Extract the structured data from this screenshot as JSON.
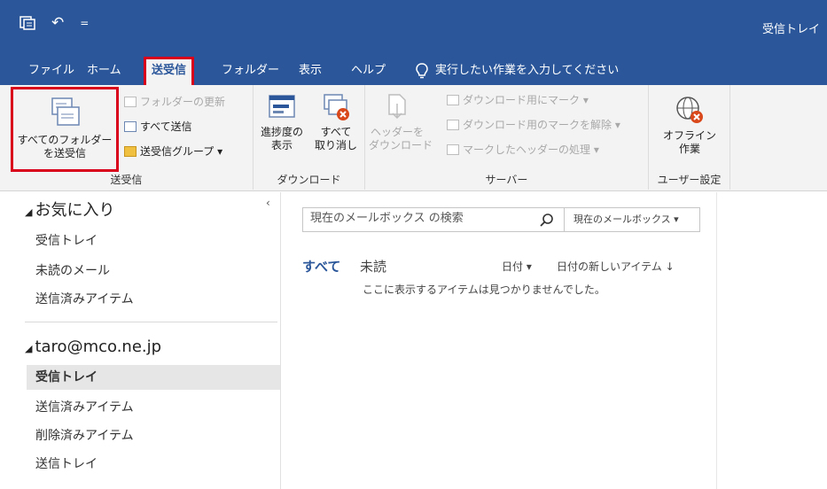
{
  "window": {
    "title": "受信トレイ"
  },
  "quick_access": {
    "icons": [
      "send-receive-icon",
      "undo-icon",
      "customize-qat-icon"
    ],
    "undo_glyph": "↶",
    "customize_glyph": "="
  },
  "tabs": [
    {
      "label": "ファイル"
    },
    {
      "label": "ホーム"
    },
    {
      "label": "送受信",
      "active": true
    },
    {
      "label": "フォルダー"
    },
    {
      "label": "表示"
    },
    {
      "label": "ヘルプ"
    }
  ],
  "tell_me": {
    "label": "実行したい作業を入力してください"
  },
  "ribbon": {
    "send_receive": {
      "group_label": "送受信",
      "send_receive_all": {
        "line1": "すべてのフォルダー",
        "line2": "を送受信"
      },
      "update_folder": "フォルダーの更新",
      "send_all": "すべて送信",
      "send_receive_groups": "送受信グループ ▾"
    },
    "download": {
      "group_label": "ダウンロード",
      "show_progress": {
        "line1": "進捗度の",
        "line2": "表示"
      },
      "cancel_all": {
        "line1": "すべて",
        "line2": "取り消し"
      }
    },
    "server": {
      "group_label": "サーバー",
      "download_headers": {
        "line1": "ヘッダーを",
        "line2": "ダウンロード"
      },
      "mark_to_download": "ダウンロード用にマーク ▾",
      "unmark_to_download": "ダウンロード用のマークを解除 ▾",
      "process_marked": "マークしたヘッダーの処理 ▾"
    },
    "preferences": {
      "group_label": "ユーザー設定",
      "work_offline": {
        "line1": "オフライン",
        "line2": "作業"
      }
    }
  },
  "nav": {
    "collapse_glyph": "‹",
    "favorites": {
      "header": "お気に入り",
      "items": [
        "受信トレイ",
        "未読のメール",
        "送信済みアイテム"
      ]
    },
    "account": {
      "header": "taro@mco.ne.jp",
      "items": [
        "受信トレイ",
        "送信済みアイテム",
        "削除済みアイテム",
        "送信トレイ"
      ]
    }
  },
  "main": {
    "search_placeholder": "現在のメールボックス の検索",
    "search_scope": "現在のメールボックス ▾",
    "filter_all": "すべて",
    "filter_unread": "未読",
    "sort_by": "日付 ▾",
    "sort_order": "日付の新しいアイテム ↓",
    "empty_message": "ここに表示するアイテムは見つかりませんでした。"
  },
  "colors": {
    "accent": "#2b579a",
    "highlight": "#d9001b",
    "ribbon": "#f3f3f3"
  }
}
